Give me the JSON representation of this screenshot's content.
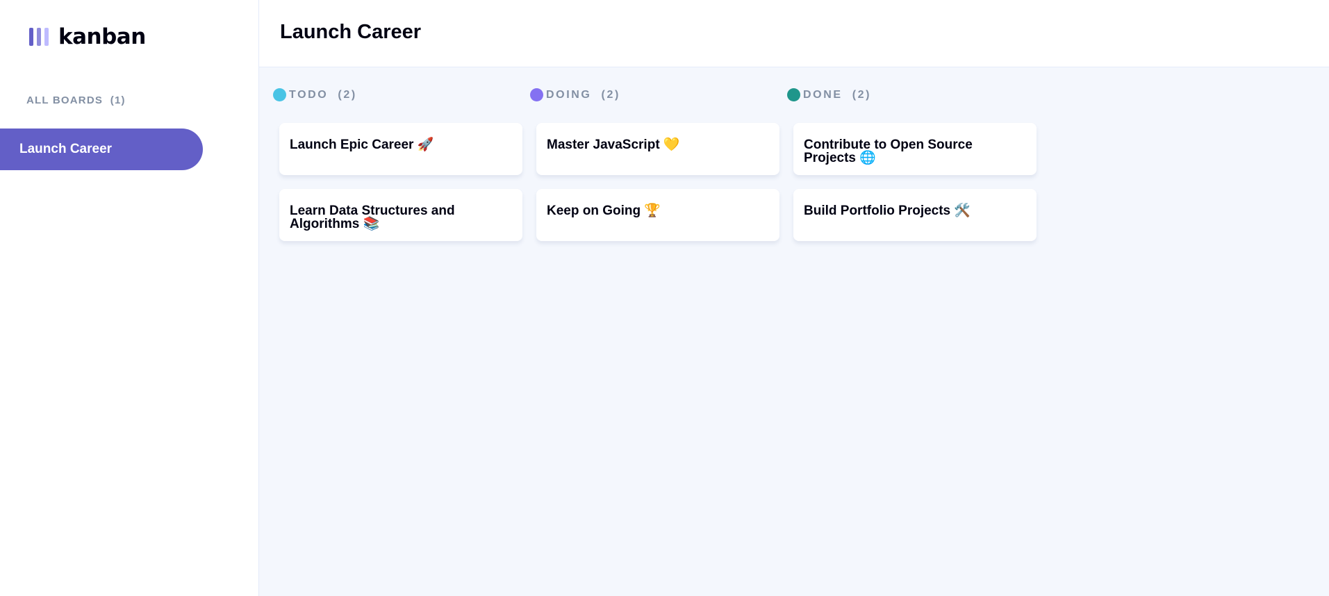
{
  "app": {
    "logo_text": "kanban"
  },
  "sidebar": {
    "all_boards_label": "ALL BOARDS  (1)",
    "boards": [
      {
        "label": "Launch Career",
        "active": true
      }
    ]
  },
  "header": {
    "title": "Launch Career"
  },
  "columns": [
    {
      "label": "TODO  (2)",
      "color": "#49c4e5",
      "cards": [
        {
          "title": "Launch Epic Career 🚀"
        },
        {
          "title": "Learn Data Structures and Algorithms 📚"
        }
      ]
    },
    {
      "label": "DOING  (2)",
      "color": "#8471f2",
      "cards": [
        {
          "title": "Master JavaScript 💛"
        },
        {
          "title": "Keep on Going 🏆"
        }
      ]
    },
    {
      "label": "DONE  (2)",
      "color": "#1f968b",
      "cards": [
        {
          "title": "Contribute to Open Source Projects 🌐"
        },
        {
          "title": "Build Portfolio Projects 🛠️"
        }
      ]
    }
  ],
  "colors": {
    "accent": "#635fc7",
    "board_bg": "#f4f7fd",
    "muted_text": "#828fa3"
  }
}
